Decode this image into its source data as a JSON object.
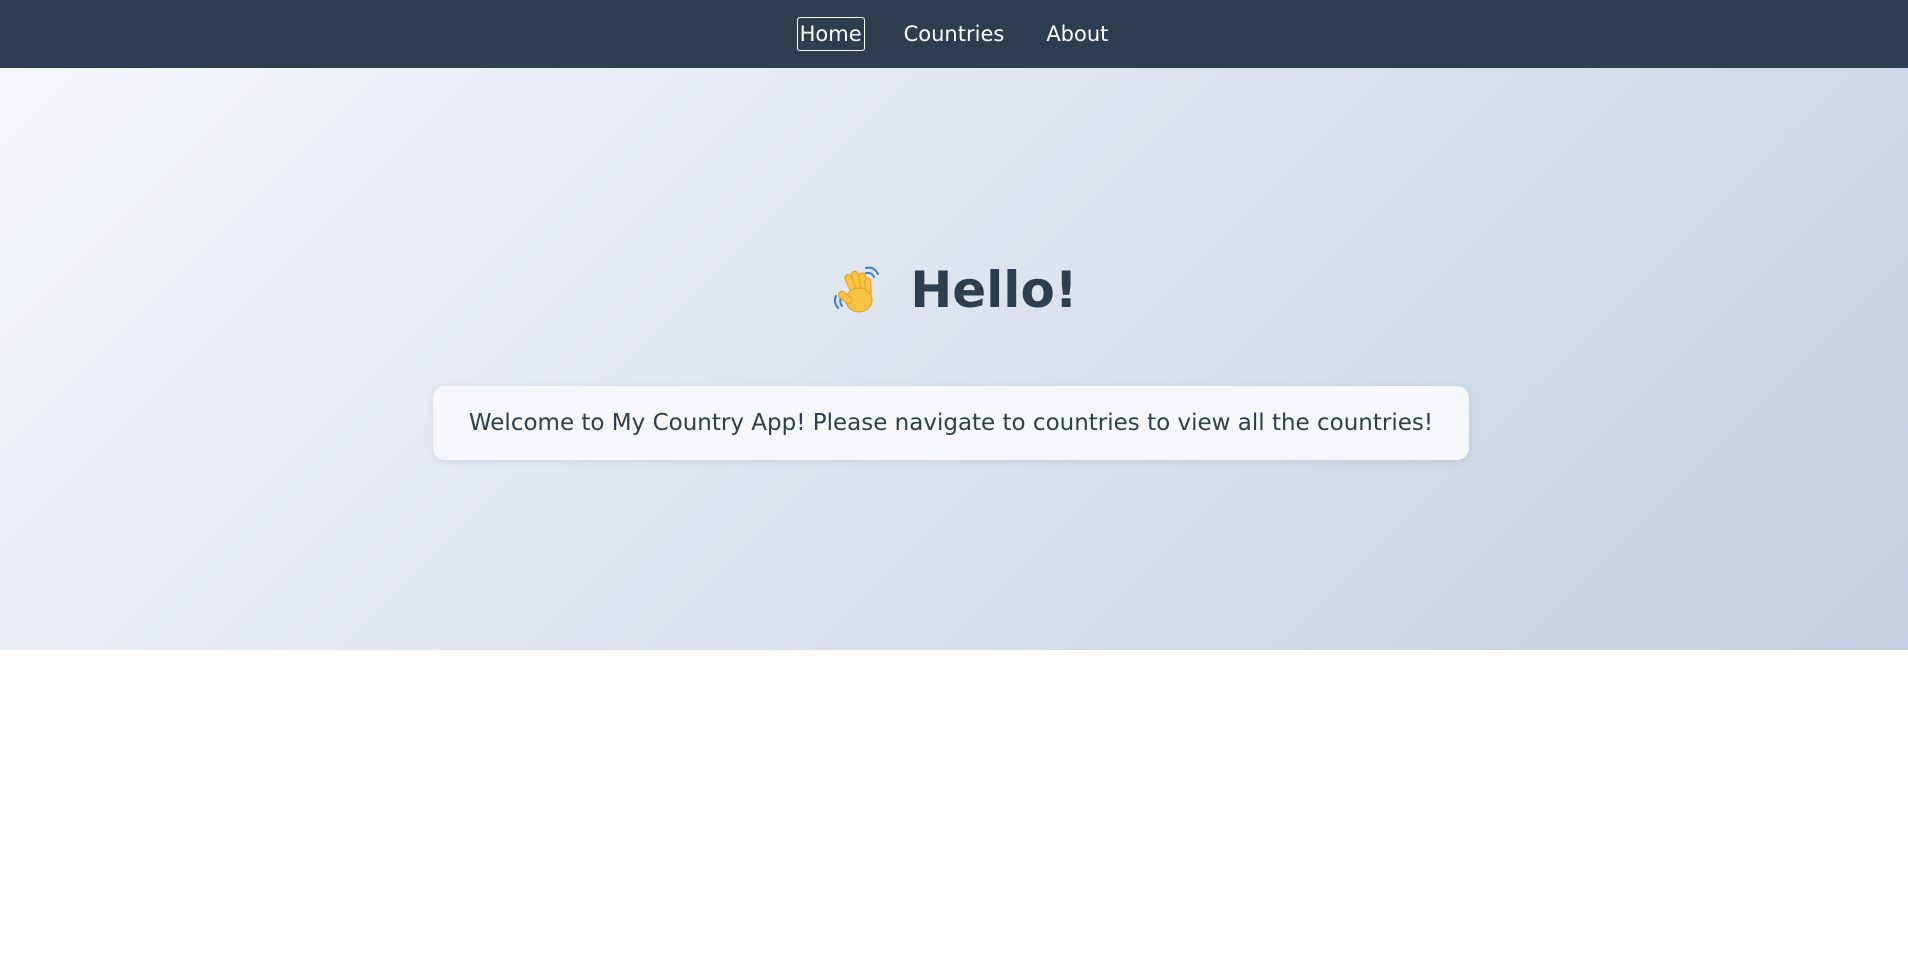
{
  "nav": {
    "items": [
      {
        "label": "Home",
        "active": true
      },
      {
        "label": "Countries",
        "active": false
      },
      {
        "label": "About",
        "active": false
      }
    ]
  },
  "hero": {
    "icon": "waving-hand-icon",
    "title": "Hello!",
    "welcome_message": "Welcome to My Country App! Please navigate to countries to view all the countries!"
  },
  "colors": {
    "navbar": "#2d3e50",
    "text_dark": "#2d3e50",
    "gradient_start": "#f5f7fa",
    "gradient_end": "#c3cfe2",
    "card_bg": "#f5f7fa"
  }
}
